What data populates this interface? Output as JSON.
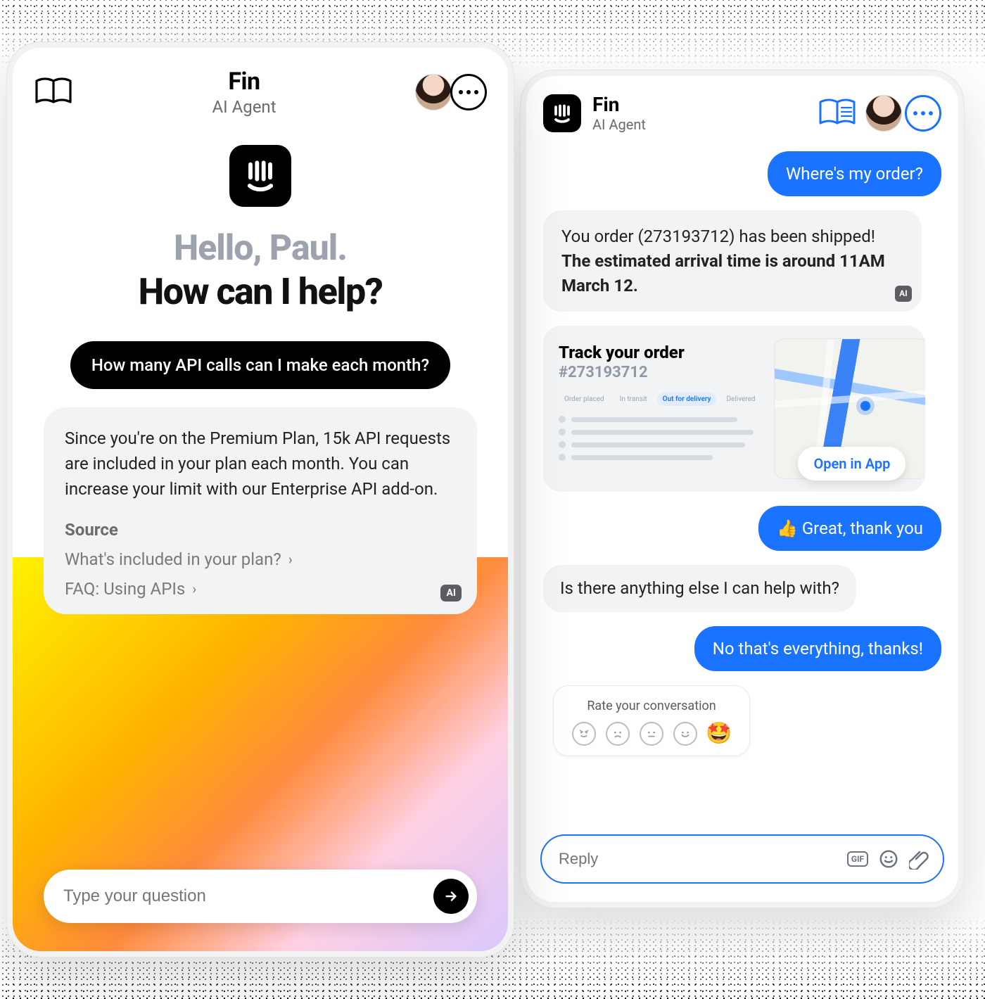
{
  "left": {
    "header": {
      "name": "Fin",
      "role": "AI Agent"
    },
    "hero": {
      "greeting": "Hello, Paul.",
      "prompt": "How can I help?"
    },
    "userMessage": "How many API calls can I make each month?",
    "aiAnswer": "Since you're on the Premium Plan, 15k API requests are included in your plan each month. You can increase your limit with our Enterprise API add-on.",
    "sourceLabel": "Source",
    "sources": [
      "What's included in your plan?",
      "FAQ: Using APIs"
    ],
    "aiBadge": "AI",
    "inputPlaceholder": "Type your question"
  },
  "right": {
    "header": {
      "name": "Fin",
      "role": "AI Agent"
    },
    "messages": {
      "u1": "Where's my order?",
      "a1_line1": "You order (273193712) has been shipped!",
      "a1_line2": "The estimated arrival time is around 11AM March 12.",
      "u2": "👍 Great, thank you",
      "a2": "Is there anything else I can help with?",
      "u3": "No that's everything, thanks!"
    },
    "track": {
      "title": "Track your order",
      "number": "#273193712",
      "steps": [
        "Order placed",
        "In transit",
        "Out for delivery",
        "Delivered"
      ],
      "activeStep": 2,
      "openLabel": "Open in App"
    },
    "rate": {
      "title": "Rate your conversation"
    },
    "aiBadge": "AI",
    "inputPlaceholder": "Reply",
    "icons": {
      "gif": "GIF"
    }
  }
}
